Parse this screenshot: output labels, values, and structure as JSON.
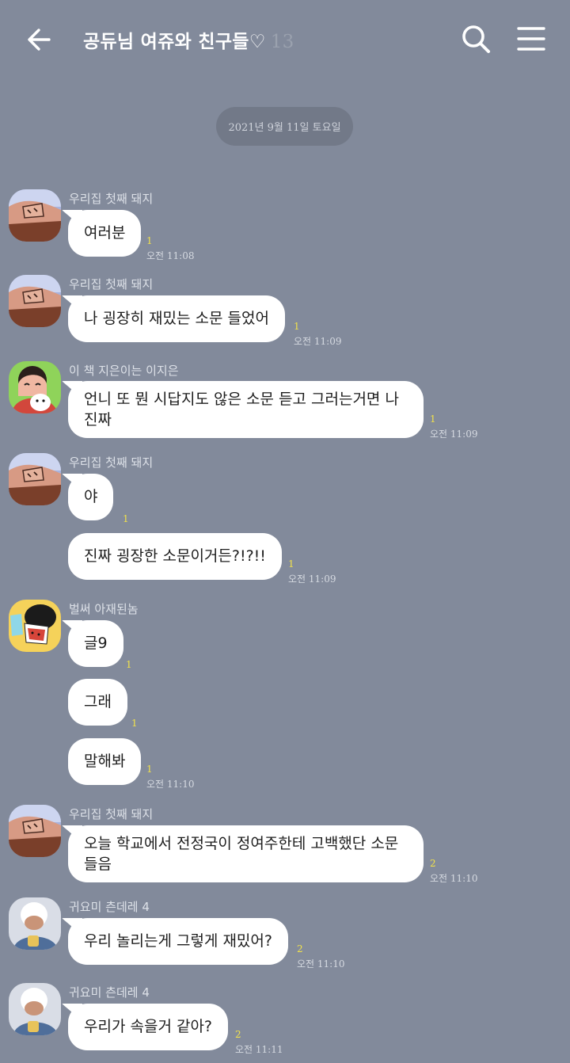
{
  "header": {
    "title": "공듀님 여쥬와 친구들♡",
    "member_count": "13",
    "icons": {
      "back": "arrow-left-icon",
      "search": "search-icon",
      "menu": "hamburger-menu-icon"
    }
  },
  "date_divider": "2021년 9월 11일 토요일",
  "senders": {
    "pig": "우리집 첫째 돼지",
    "jieun": "이 책 지은이는 이지은",
    "ajae": "벌써 아재된놈",
    "tsundere": "귀요미 츤데레 4"
  },
  "messages": [
    {
      "text": "여러분",
      "unread": "1",
      "time": "오전 11:08"
    },
    {
      "text": "나 굉장히 재밌는 소문 들었어",
      "unread": "1",
      "time": "오전 11:09"
    },
    {
      "text": "언니 또 뭔 시답지도 않은 소문 듣고 그러는거면 나 진짜",
      "unread": "1",
      "time": "오전 11:09"
    },
    {
      "text": "야",
      "unread": "1"
    },
    {
      "text": "진짜 굉장한 소문이거든?!?!!",
      "unread": "1",
      "time": "오전 11:09"
    },
    {
      "text": "글9",
      "unread": "1"
    },
    {
      "text": "그래",
      "unread": "1"
    },
    {
      "text": "말해봐",
      "unread": "1",
      "time": "오전 11:10"
    },
    {
      "text": "오늘 학교에서 전정국이 정여주한테 고백했단 소문 들음",
      "unread": "2",
      "time": "오전 11:10"
    },
    {
      "text": "우리 놀리는게 그렇게 재밌어?",
      "unread": "2",
      "time": "오전 11:10"
    },
    {
      "text": "우리가 속을거 같아?",
      "unread": "2",
      "time": "오전 11:11"
    }
  ],
  "colors": {
    "background": "#828a9b",
    "bubble": "#ffffff",
    "unread": "#f2e24b",
    "date_pill": "#727988"
  }
}
